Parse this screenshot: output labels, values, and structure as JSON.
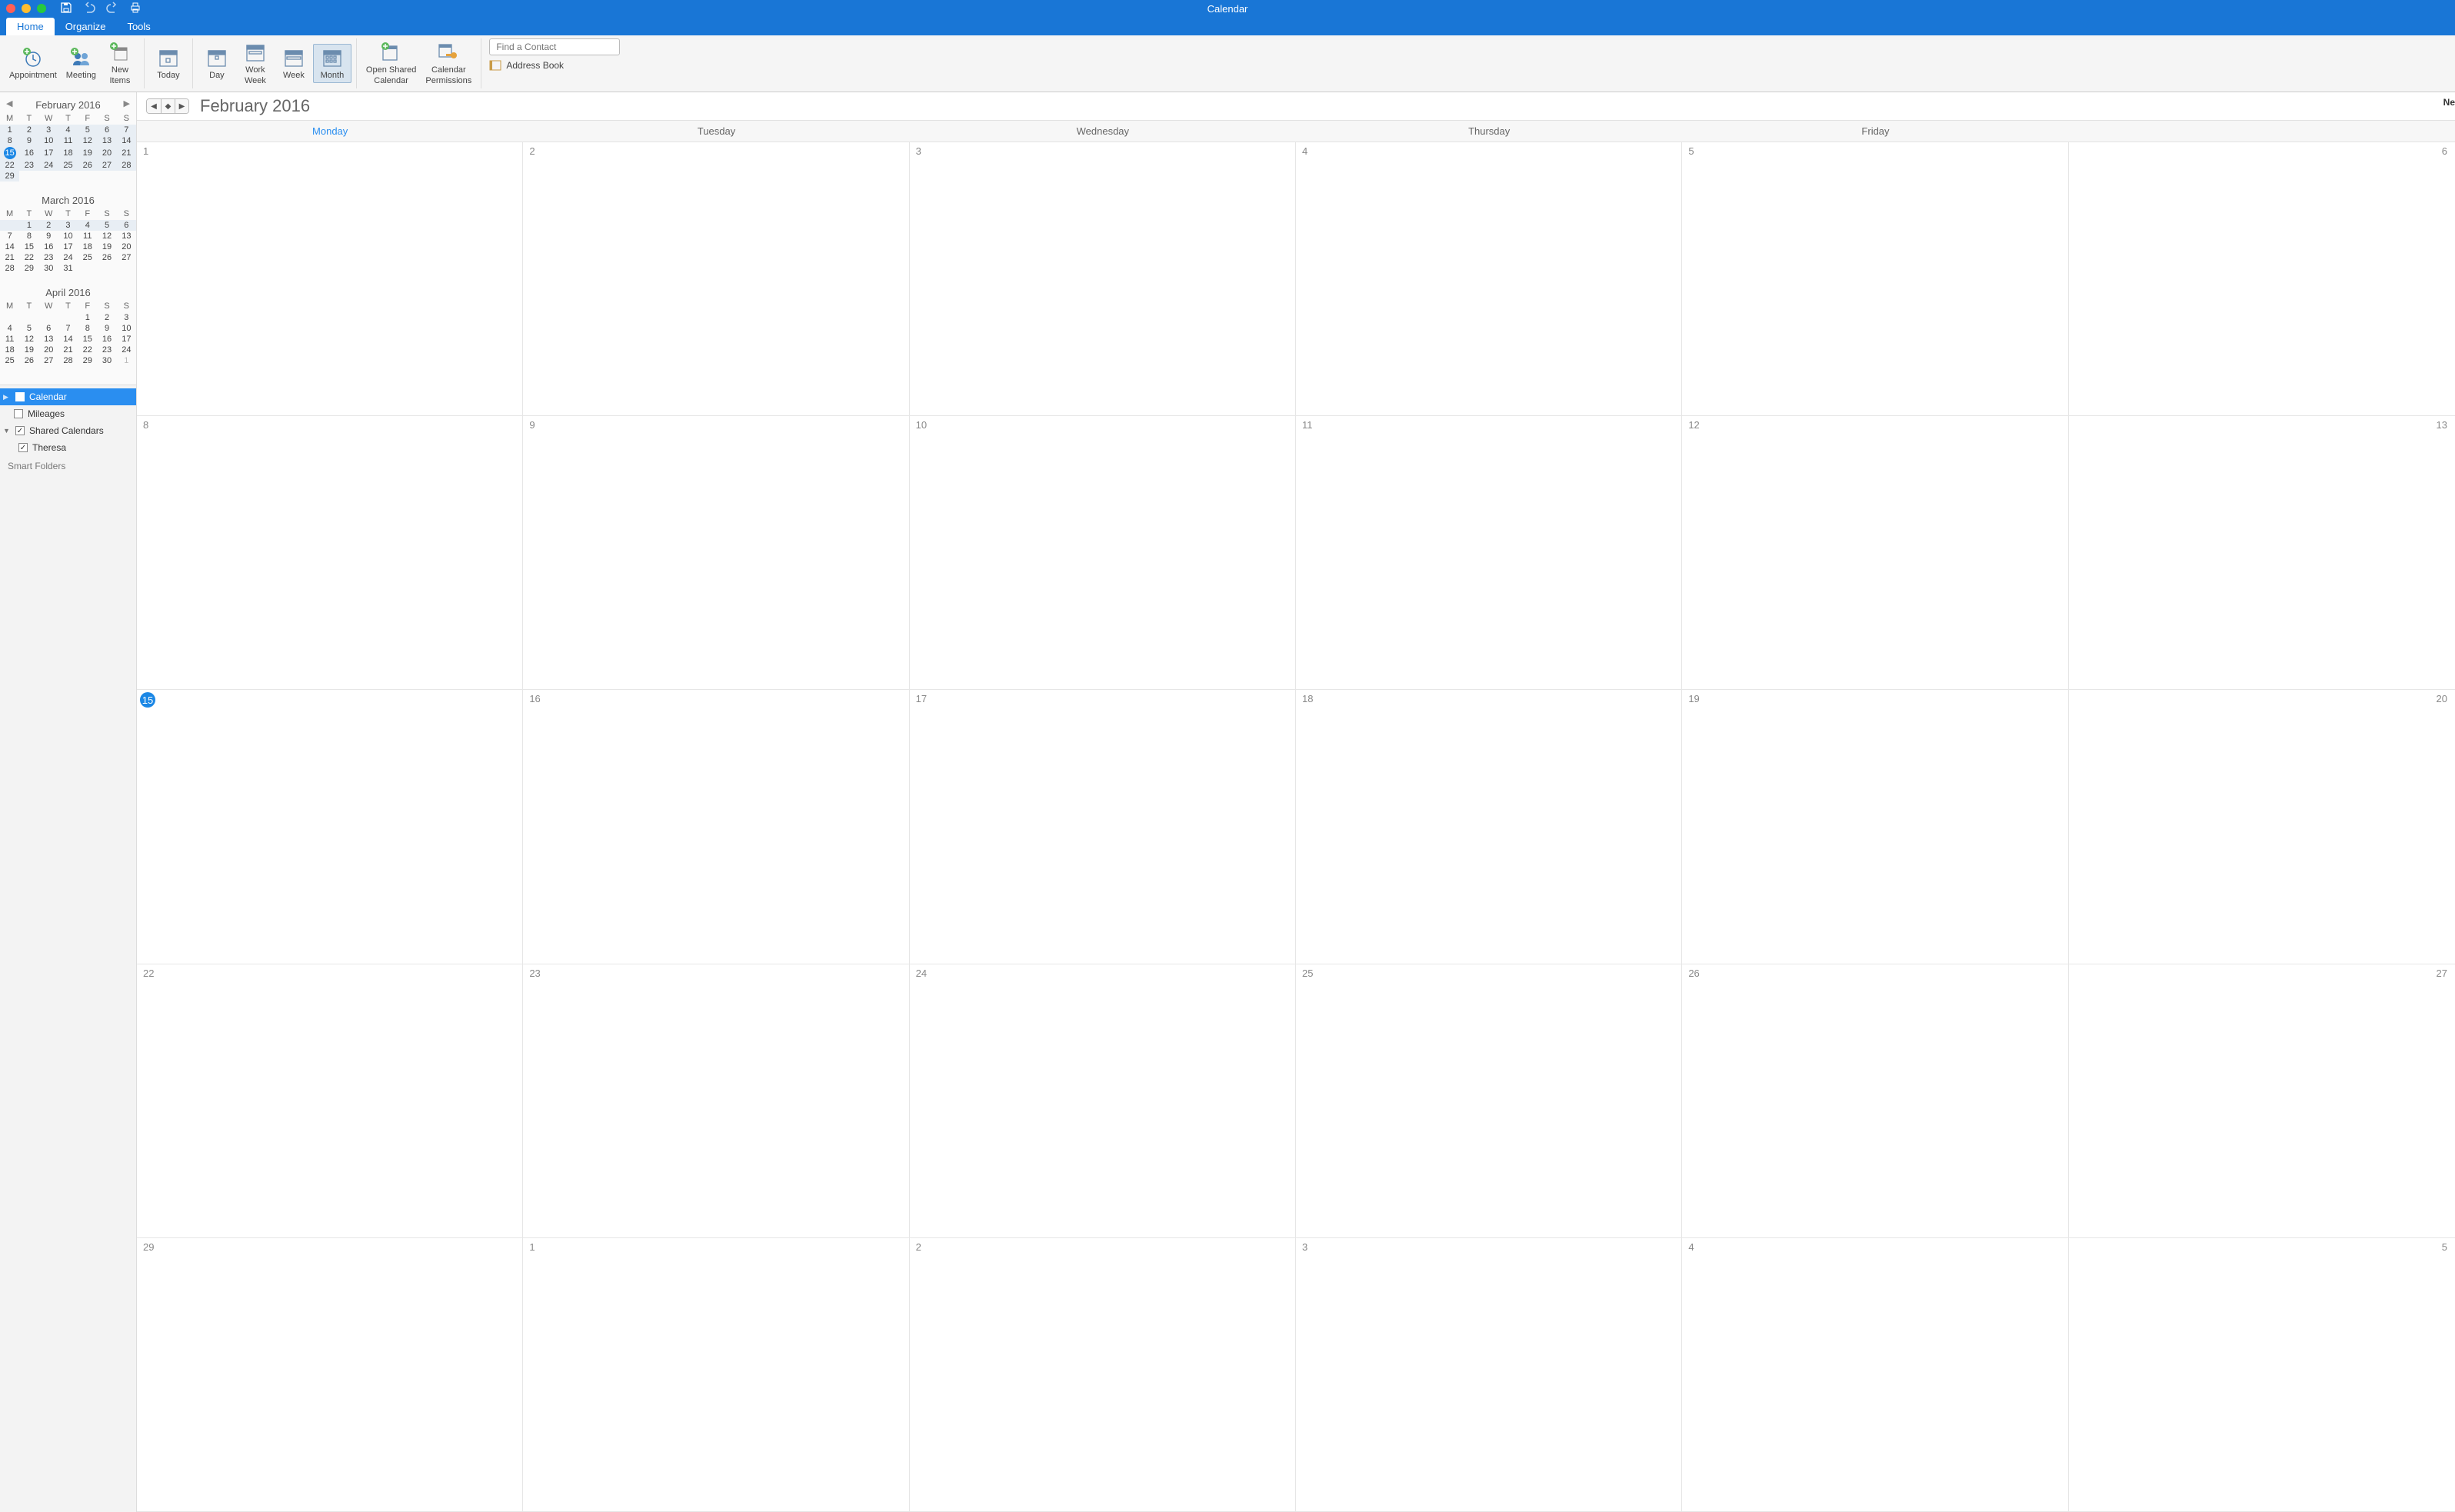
{
  "titlebar": {
    "title": "Calendar"
  },
  "tabs": [
    {
      "label": "Home",
      "active": true
    },
    {
      "label": "Organize",
      "active": false
    },
    {
      "label": "Tools",
      "active": false
    }
  ],
  "ribbon": {
    "appointment": "Appointment",
    "meeting": "Meeting",
    "new_items": "New\nItems",
    "today": "Today",
    "day": "Day",
    "work_week": "Work\nWeek",
    "week": "Week",
    "month": "Month",
    "open_shared": "Open Shared\nCalendar",
    "cal_perms": "Calendar\nPermissions",
    "find_contact_placeholder": "Find a Contact",
    "address_book": "Address Book"
  },
  "sidebar": {
    "dow": [
      "M",
      "T",
      "W",
      "T",
      "F",
      "S",
      "S"
    ],
    "minicals": [
      {
        "title": "February 2016",
        "show_nav": true,
        "rows": [
          [
            {
              "d": "1",
              "hl": true
            },
            {
              "d": "2",
              "hl": true
            },
            {
              "d": "3",
              "hl": true
            },
            {
              "d": "4",
              "hl": true
            },
            {
              "d": "5",
              "hl": true
            },
            {
              "d": "6",
              "hl": true
            },
            {
              "d": "7",
              "hl": true
            }
          ],
          [
            {
              "d": "8",
              "hl": true
            },
            {
              "d": "9",
              "hl": true
            },
            {
              "d": "10",
              "hl": true
            },
            {
              "d": "11",
              "hl": true
            },
            {
              "d": "12",
              "hl": true
            },
            {
              "d": "13",
              "hl": true
            },
            {
              "d": "14",
              "hl": true
            }
          ],
          [
            {
              "d": "15",
              "hl": true,
              "today": true
            },
            {
              "d": "16",
              "hl": true
            },
            {
              "d": "17",
              "hl": true
            },
            {
              "d": "18",
              "hl": true
            },
            {
              "d": "19",
              "hl": true
            },
            {
              "d": "20",
              "hl": true
            },
            {
              "d": "21",
              "hl": true
            }
          ],
          [
            {
              "d": "22",
              "hl": true
            },
            {
              "d": "23",
              "hl": true
            },
            {
              "d": "24",
              "hl": true
            },
            {
              "d": "25",
              "hl": true
            },
            {
              "d": "26",
              "hl": true
            },
            {
              "d": "27",
              "hl": true
            },
            {
              "d": "28",
              "hl": true
            }
          ],
          [
            {
              "d": "29",
              "hl": true
            },
            {
              "d": ""
            },
            {
              "d": ""
            },
            {
              "d": ""
            },
            {
              "d": ""
            },
            {
              "d": ""
            },
            {
              "d": ""
            }
          ]
        ]
      },
      {
        "title": "March 2016",
        "show_nav": false,
        "rows": [
          [
            {
              "d": "",
              "hl": true
            },
            {
              "d": "1",
              "hl": true
            },
            {
              "d": "2",
              "hl": true
            },
            {
              "d": "3",
              "hl": true
            },
            {
              "d": "4",
              "hl": true
            },
            {
              "d": "5",
              "hl": true
            },
            {
              "d": "6",
              "hl": true
            }
          ],
          [
            {
              "d": "7"
            },
            {
              "d": "8"
            },
            {
              "d": "9"
            },
            {
              "d": "10"
            },
            {
              "d": "11"
            },
            {
              "d": "12"
            },
            {
              "d": "13"
            }
          ],
          [
            {
              "d": "14"
            },
            {
              "d": "15"
            },
            {
              "d": "16"
            },
            {
              "d": "17"
            },
            {
              "d": "18"
            },
            {
              "d": "19"
            },
            {
              "d": "20"
            }
          ],
          [
            {
              "d": "21"
            },
            {
              "d": "22"
            },
            {
              "d": "23"
            },
            {
              "d": "24"
            },
            {
              "d": "25"
            },
            {
              "d": "26"
            },
            {
              "d": "27"
            }
          ],
          [
            {
              "d": "28"
            },
            {
              "d": "29"
            },
            {
              "d": "30"
            },
            {
              "d": "31"
            },
            {
              "d": ""
            },
            {
              "d": ""
            },
            {
              "d": ""
            }
          ]
        ]
      },
      {
        "title": "April 2016",
        "show_nav": false,
        "rows": [
          [
            {
              "d": ""
            },
            {
              "d": ""
            },
            {
              "d": ""
            },
            {
              "d": ""
            },
            {
              "d": "1"
            },
            {
              "d": "2"
            },
            {
              "d": "3"
            }
          ],
          [
            {
              "d": "4"
            },
            {
              "d": "5"
            },
            {
              "d": "6"
            },
            {
              "d": "7"
            },
            {
              "d": "8"
            },
            {
              "d": "9"
            },
            {
              "d": "10"
            }
          ],
          [
            {
              "d": "11"
            },
            {
              "d": "12"
            },
            {
              "d": "13"
            },
            {
              "d": "14"
            },
            {
              "d": "15"
            },
            {
              "d": "16"
            },
            {
              "d": "17"
            }
          ],
          [
            {
              "d": "18"
            },
            {
              "d": "19"
            },
            {
              "d": "20"
            },
            {
              "d": "21"
            },
            {
              "d": "22"
            },
            {
              "d": "23"
            },
            {
              "d": "24"
            }
          ],
          [
            {
              "d": "25"
            },
            {
              "d": "26"
            },
            {
              "d": "27"
            },
            {
              "d": "28"
            },
            {
              "d": "29"
            },
            {
              "d": "30"
            },
            {
              "d": "1",
              "dim": true
            }
          ]
        ]
      }
    ],
    "tree": {
      "calendar": "Calendar",
      "mileages": "Mileages",
      "shared": "Shared Calendars",
      "theresa": "Theresa",
      "smart": "Smart Folders"
    }
  },
  "calendar": {
    "title": "February 2016",
    "right_trunc": "Ne",
    "day_headers": [
      {
        "label": "Monday",
        "active": true
      },
      {
        "label": "Tuesday",
        "active": false
      },
      {
        "label": "Wednesday",
        "active": false
      },
      {
        "label": "Thursday",
        "active": false
      },
      {
        "label": "Friday",
        "active": false
      }
    ],
    "weeks": [
      [
        {
          "d": "1"
        },
        {
          "d": "2"
        },
        {
          "d": "3"
        },
        {
          "d": "4"
        },
        {
          "d": "5"
        },
        {
          "d": "6",
          "right": true
        }
      ],
      [
        {
          "d": "8"
        },
        {
          "d": "9"
        },
        {
          "d": "10"
        },
        {
          "d": "11"
        },
        {
          "d": "12"
        },
        {
          "d": "13",
          "right": true
        }
      ],
      [
        {
          "d": "15",
          "today": true
        },
        {
          "d": "16"
        },
        {
          "d": "17"
        },
        {
          "d": "18"
        },
        {
          "d": "19"
        },
        {
          "d": "20",
          "right": true
        }
      ],
      [
        {
          "d": "22"
        },
        {
          "d": "23"
        },
        {
          "d": "24"
        },
        {
          "d": "25"
        },
        {
          "d": "26"
        },
        {
          "d": "27",
          "right": true
        }
      ],
      [
        {
          "d": "29"
        },
        {
          "d": "1"
        },
        {
          "d": "2"
        },
        {
          "d": "3"
        },
        {
          "d": "4"
        },
        {
          "d": "5",
          "right": true
        }
      ]
    ]
  }
}
